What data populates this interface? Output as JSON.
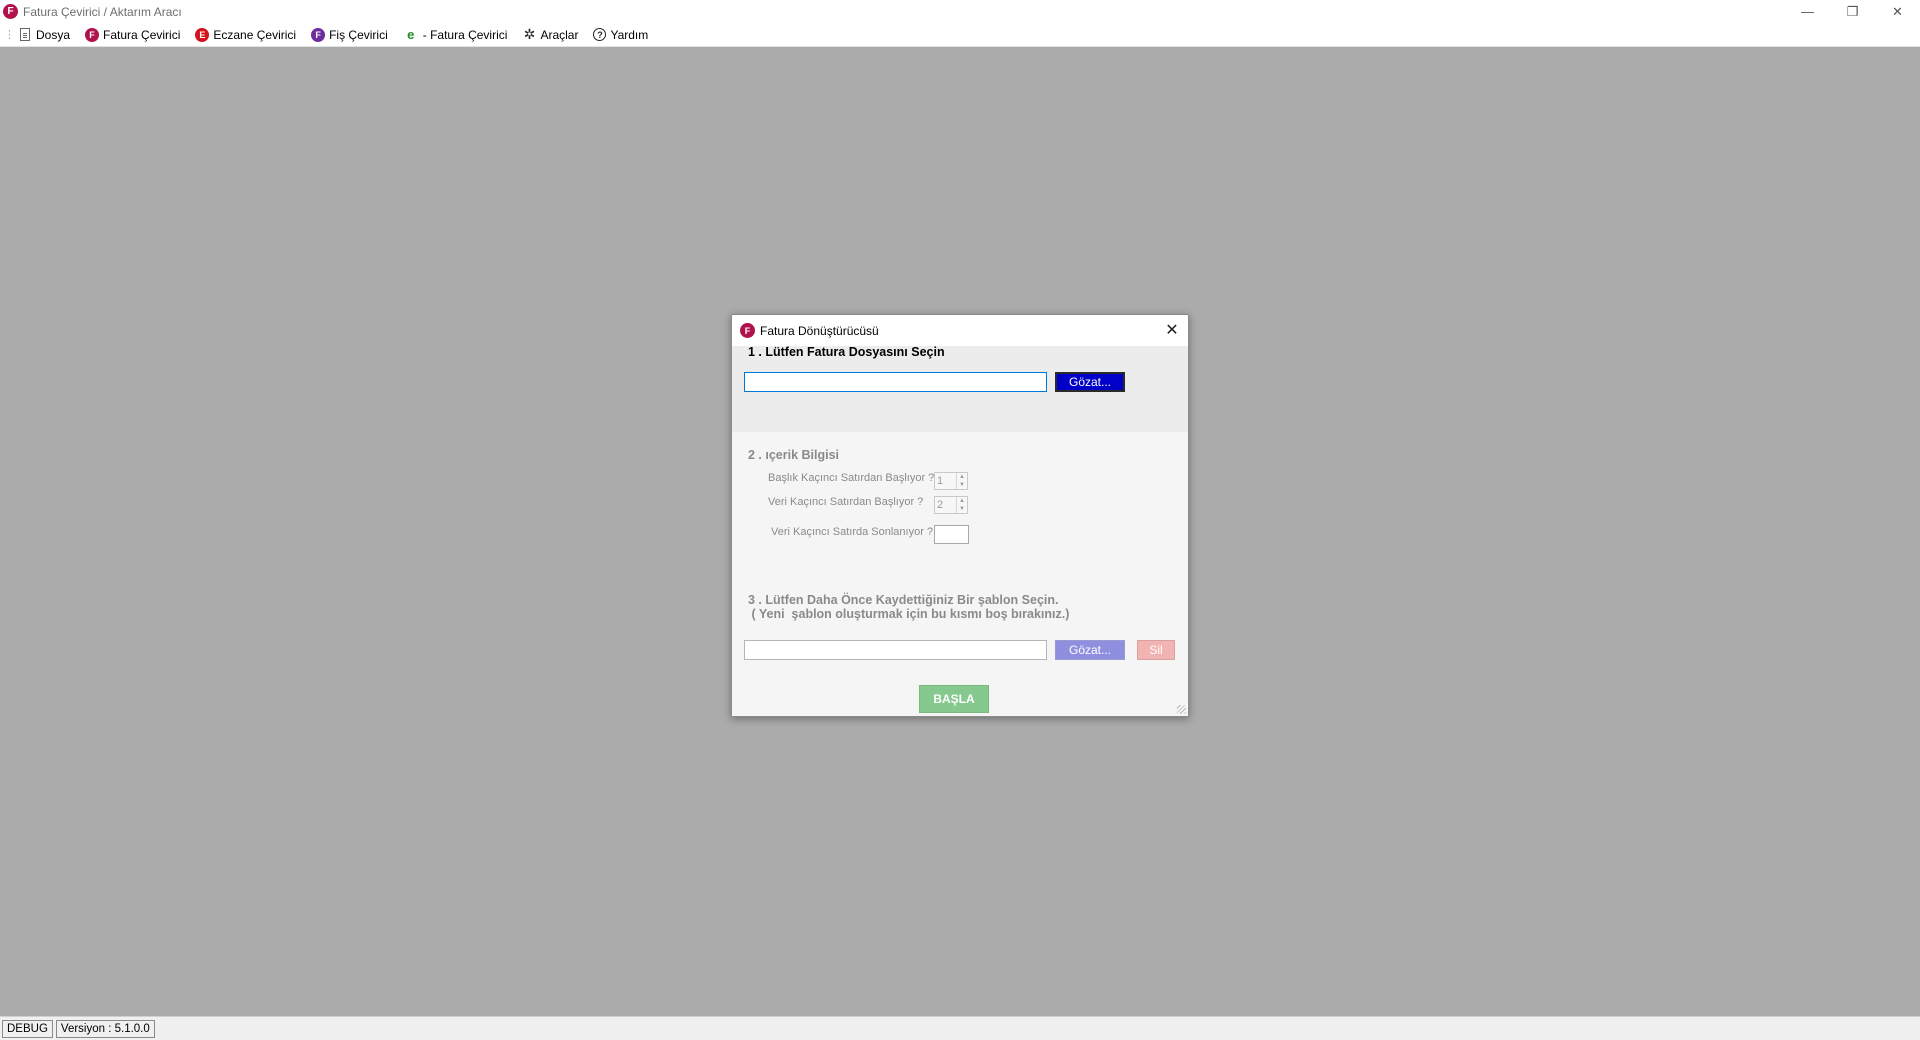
{
  "window": {
    "title": "Fatura Çevirici / Aktarım Aracı",
    "logo_letter": "F",
    "controls": {
      "minimize": "—",
      "restore": "❐",
      "close": "✕"
    }
  },
  "menu": {
    "items": [
      {
        "label": "Dosya",
        "icon": "document-icon"
      },
      {
        "label": "Fatura Çevirici",
        "icon": "f-logo-icon",
        "letter": "F"
      },
      {
        "label": "Eczane Çevirici",
        "icon": "e-logo-icon",
        "letter": "E"
      },
      {
        "label": "Fiş Çevirici",
        "icon": "fis-logo-icon",
        "letter": "F"
      },
      {
        "label": "e- Fatura Çevirici",
        "display": "- Fatura Çevirici",
        "icon": "efatura-icon",
        "letter": "e"
      },
      {
        "label": "Araçlar",
        "icon": "tools-icon",
        "glyph": "✲"
      },
      {
        "label": "Yardım",
        "icon": "help-icon",
        "glyph": "?"
      }
    ]
  },
  "dialog": {
    "title": "Fatura Dönüştürücüsü",
    "logo_letter": "F",
    "close": "✕",
    "step1": {
      "label": "1 . Lütfen Fatura Dosyasını Seçin",
      "file_value": "",
      "browse_label": "Gözat..."
    },
    "step2": {
      "label": "2 . ıçerik Bilgisi",
      "header_row_label": "Başlık Kaçıncı Satırdan Başlıyor ?",
      "header_row_value": "1",
      "data_row_label": "Veri Kaçıncı Satırdan Başlıyor ?",
      "data_row_value": "2",
      "end_row_label": "Veri Kaçıncı Satırda Sonlanıyor ?",
      "end_row_value": ""
    },
    "step3": {
      "label_line1": "3 . Lütfen Daha Önce Kaydettiğiniz Bir şablon Seçin.",
      "label_line2": " ( Yeni  şablon oluşturmak için bu kısmı boş bırakınız.)",
      "template_value": "",
      "browse_label": "Gözat...",
      "delete_label": "Sil"
    },
    "start_label": "BAŞLA",
    "spin_up": "▲",
    "spin_down": "▼"
  },
  "status": {
    "mode": "DEBUG",
    "version": "Versiyon : 5.1.0.0"
  },
  "colors": {
    "workspace": "#ababab",
    "brand": "#b0124e",
    "browse_active": "#0000c8",
    "browse_disabled": "#8f8fe0",
    "delete_disabled": "#f2b3b3",
    "start_disabled": "#86c98e"
  }
}
